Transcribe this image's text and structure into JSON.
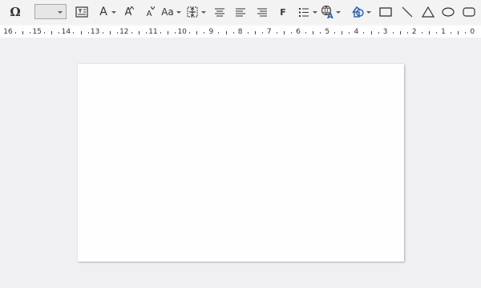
{
  "toolbar": {
    "omega_symbol": "Ω",
    "font_color_letter": "A",
    "grow_letter": "A",
    "shrink_letter": "A",
    "change_case_label": "Aa",
    "bold_letter": "F"
  },
  "ruler": {
    "numbers": [
      "16",
      "15",
      "14",
      "13",
      "12",
      "11",
      "10",
      "9",
      "8",
      "7",
      "6",
      "5",
      "4",
      "3",
      "2",
      "1",
      "0"
    ]
  },
  "colors": {
    "toolbar_bg": "#f3f3f3",
    "workspace_bg": "#f0eff1",
    "slide_bg": "#fffeff",
    "accent_blue": "#2b5fa8"
  }
}
